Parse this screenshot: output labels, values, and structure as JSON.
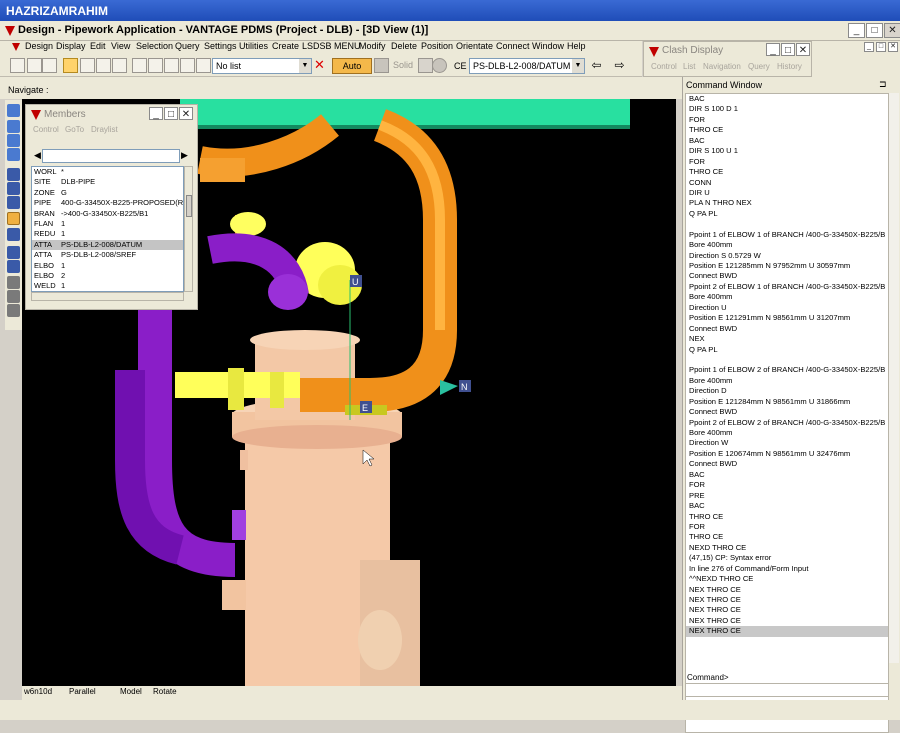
{
  "user": "HAZRIZAMRAHIM",
  "window_title": "Design - Pipework Application - VANTAGE PDMS (Project - DLB) - [3D View (1)]",
  "menu": [
    "Design",
    "Display",
    "Edit",
    "View",
    "Selection",
    "Query",
    "Settings",
    "Utilities",
    "Create",
    "LSDSB MENU",
    "Modify",
    "Delete",
    "Position",
    "Orientate",
    "Connect",
    "Window",
    "Help"
  ],
  "toolbar": {
    "list_value": "No list",
    "auto_label": "Auto",
    "solid_label": "Solid",
    "ce_label": "CE",
    "ce_value": "PS-DLB-L2-008/DATUM"
  },
  "clash": {
    "title": "Clash Display",
    "menu": [
      "Control",
      "List",
      "Navigation",
      "Query",
      "History"
    ]
  },
  "navigate_label": "Navigate :",
  "members": {
    "title": "Members",
    "menu": [
      "Control",
      "GoTo",
      "Draylist"
    ],
    "rows": [
      {
        "k": "WORL",
        "v": "*"
      },
      {
        "k": "SITE",
        "v": "DLB-PIPE"
      },
      {
        "k": "ZONE",
        "v": "G"
      },
      {
        "k": "PIPE",
        "v": "400-G-33450X-B225-PROPOSED(R"
      },
      {
        "k": "BRAN",
        "v": "->400-G-33450X-B225/B1"
      },
      {
        "k": "FLAN",
        "v": "1"
      },
      {
        "k": "REDU",
        "v": "1"
      },
      {
        "k": "ATTA",
        "v": "PS-DLB-L2-008/DATUM"
      },
      {
        "k": "ATTA",
        "v": "PS-DLB-L2-008/SREF"
      },
      {
        "k": "ELBO",
        "v": "1"
      },
      {
        "k": "ELBO",
        "v": "2"
      },
      {
        "k": "WELD",
        "v": "1"
      }
    ],
    "selected_index": 7
  },
  "view_status": {
    "name": "w6n10d",
    "projection": "Parallel",
    "mode": "Model",
    "action": "Rotate"
  },
  "axis_labels": {
    "u": "U",
    "e": "E",
    "n": "N"
  },
  "command_window": {
    "title": "Command Window",
    "lines": [
      "BAC",
      "DIR S 100 D 1",
      "FOR",
      "THRO CE",
      "BAC",
      "DIR S 100 U 1",
      "FOR",
      "THRO CE",
      "CONN",
      "DIR U",
      "PLA N THRO NEX",
      "Q PA PL",
      "",
      "Ppoint 1 of ELBOW 1 of BRANCH /400-G-33450X-B225/B",
      "Bore 400mm",
      "Direction S 0.5729 W",
      "Position E 121285mm N 97952mm U 30597mm",
      "Connect BWD",
      "Ppoint 2 of ELBOW 1 of BRANCH /400-G-33450X-B225/B",
      "Bore 400mm",
      "Direction U",
      "Position E 121291mm N 98561mm U 31207mm",
      "Connect BWD",
      "NEX",
      "Q PA PL",
      "",
      "Ppoint 1 of ELBOW 2 of BRANCH /400-G-33450X-B225/B",
      "Bore 400mm",
      "Direction D",
      "Position E 121284mm N 98561mm U 31866mm",
      "Connect BWD",
      "Ppoint 2 of ELBOW 2 of BRANCH /400-G-33450X-B225/B",
      "Bore 400mm",
      "Direction W",
      "Position E 120674mm N 98561mm U 32476mm",
      "Connect BWD",
      "BAC",
      "FOR",
      "PRE",
      "BAC",
      "THRO CE",
      "FOR",
      "THRO CE",
      "NEXD THRO CE",
      "(47,15)   CP: Syntax error",
      " In line 276 of Command/Form Input",
      "^^NEXD THRO CE",
      "NEX THRO CE",
      "NEX THRO CE",
      "NEX THRO CE",
      "NEX THRO CE",
      "NEX THRO CE"
    ],
    "selected_index": 51,
    "command_label": "Command>"
  },
  "colors": {
    "orange_pipe": "#f0901a",
    "yellow_pipe": "#ffff5a",
    "purple_pipe": "#8a1ec8",
    "vessel": "#f5c9a8",
    "teal_beam": "#28e0a0"
  }
}
